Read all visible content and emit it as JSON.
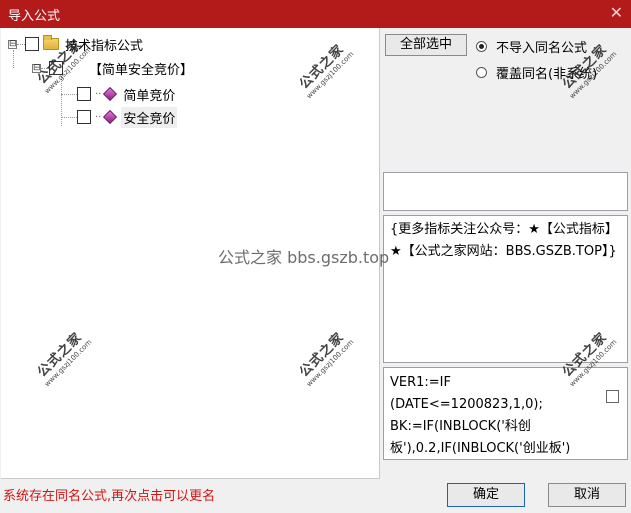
{
  "window": {
    "title": "导入公式",
    "close_glyph": "✕"
  },
  "tree": {
    "root": {
      "label": "技术指标公式",
      "expander": "⊟"
    },
    "group": {
      "label": "【简单安全竞价】",
      "expander": "⊟"
    },
    "items": [
      {
        "label": "简单竞价"
      },
      {
        "label": "安全竞价"
      }
    ]
  },
  "options": {
    "select_all_label": "全部选中",
    "radios": [
      {
        "label": "不导入同名公式",
        "selected": true
      },
      {
        "label": "覆盖同名(非系统)",
        "selected": false
      }
    ]
  },
  "info_text": "{更多指标关注公众号：★【公式指标】★【公式之家网站：BBS.GSZB.TOP】}",
  "code_text": "VER1:=IF\n(DATE<=1200823,1,0);\nBK:=IF(INBLOCK('科创\n板'),0.2,IF(INBLOCK('创业板')",
  "status_text": "系统存在同名公式,再次点击可以更名",
  "footer": {
    "ok_label": "确定",
    "cancel_label": "取消"
  },
  "watermark": {
    "cn": "公式之家",
    "url": "www.gszj100.com",
    "center": "公式之家 bbs.gszb.top"
  },
  "colors": {
    "titlebar": "#b31a1a",
    "status": "#d21414",
    "primary_border": "#1c64b5"
  }
}
